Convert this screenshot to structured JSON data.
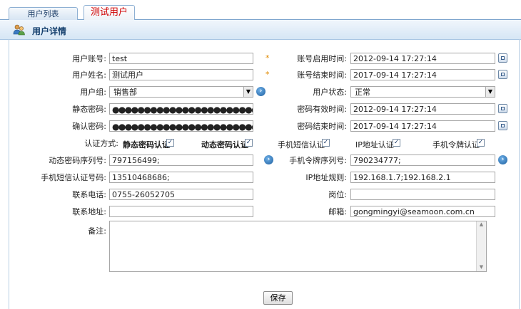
{
  "tabs": [
    {
      "label": "用户列表"
    },
    {
      "label": "测试用户"
    }
  ],
  "header": {
    "title": "用户详情"
  },
  "form": {
    "account": {
      "label": "用户账号:",
      "value": "test"
    },
    "name": {
      "label": "用户姓名:",
      "value": "测试用户"
    },
    "group": {
      "label": "用户组:",
      "value": "销售部"
    },
    "static_pwd": {
      "label": "静态密码:",
      "value": "●●●●●●●●●●●●●●●●●●●●●●●●●●●●●●●●●●●●●●●●●●●●"
    },
    "confirm_pwd": {
      "label": "确认密码:",
      "value": "●●●●●●●●●●●●●●●●●●●●●●●●●●●●●●●●●●●●●●●●●●●●"
    },
    "enable_time": {
      "label": "账号启用时间:",
      "value": "2012-09-14 17:27:14"
    },
    "end_time": {
      "label": "账号结束时间:",
      "value": "2017-09-14 17:27:14"
    },
    "status": {
      "label": "用户状态:",
      "value": "正常"
    },
    "pwd_valid_time": {
      "label": "密码有效时间:",
      "value": "2012-09-14 17:27:14"
    },
    "pwd_end_time": {
      "label": "密码结束时间:",
      "value": "2017-09-14 17:27:14"
    },
    "auth": {
      "label": "认证方式:",
      "options": [
        {
          "label": "静态密码认证",
          "checked": true
        },
        {
          "label": "动态密码认证",
          "checked": true
        },
        {
          "label": "手机短信认证",
          "checked": true
        },
        {
          "label": "IP地址认证",
          "checked": true
        },
        {
          "label": "手机令牌认证",
          "checked": true
        }
      ]
    },
    "dyn_serial": {
      "label": "动态密码序列号:",
      "value": "797156499;"
    },
    "token_serial": {
      "label": "手机令牌序列号:",
      "value": "790234777;"
    },
    "sms_number": {
      "label": "手机短信认证号码:",
      "value": "13510468686;"
    },
    "ip_rule": {
      "label": "IP地址规则:",
      "value": "192.168.1.7;192.168.2.1"
    },
    "phone": {
      "label": "联系电话:",
      "value": "0755-26052705"
    },
    "position": {
      "label": "岗位:",
      "value": ""
    },
    "address": {
      "label": "联系地址:",
      "value": ""
    },
    "email": {
      "label": "邮箱:",
      "value": "gongmingyi@seamoon.com.cn"
    },
    "remark": {
      "label": "备注:",
      "value": ""
    },
    "required_mark": "*",
    "check_mark": "✓",
    "save_label": "保存"
  },
  "icons": {
    "title": "users-icon",
    "calendar": "calendar-icon",
    "go": "arrow-right-icon",
    "dropdown": "chevron-down-icon"
  },
  "colors": {
    "tab_active_text": "#d00000",
    "title_text": "#15406e",
    "required": "#e08a00"
  }
}
